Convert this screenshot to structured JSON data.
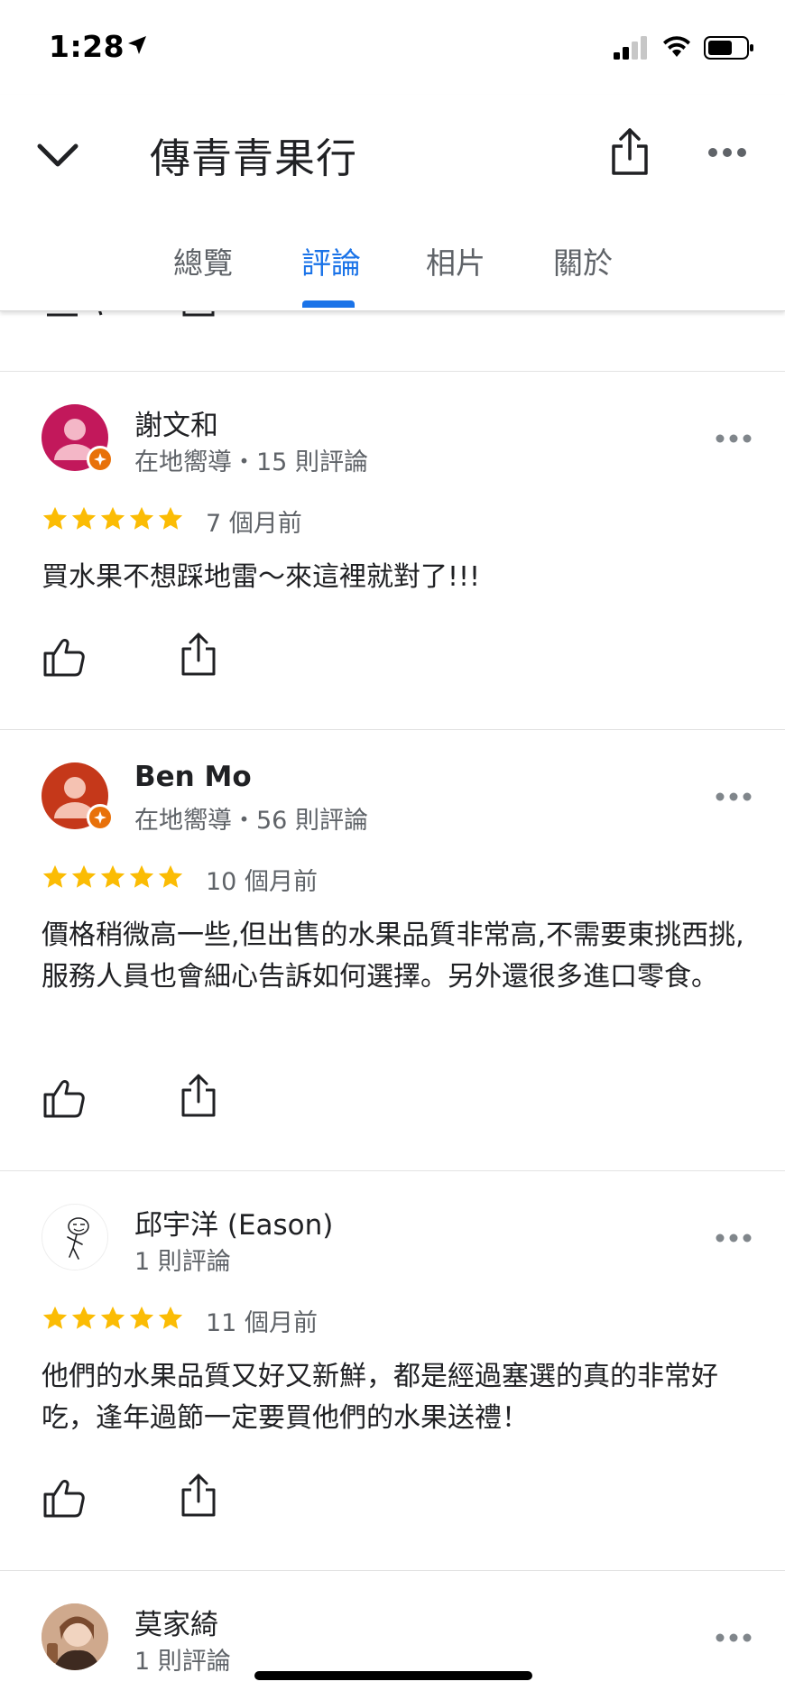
{
  "status": {
    "time": "1:28"
  },
  "header": {
    "title": "傳青青果行"
  },
  "tabs": [
    {
      "label": "總覽",
      "active": false
    },
    {
      "label": "評論",
      "active": true
    },
    {
      "label": "相片",
      "active": false
    },
    {
      "label": "關於",
      "active": false
    }
  ],
  "colors": {
    "accent": "#1a73e8",
    "star": "#fbbc04",
    "badge": "#e8710a"
  },
  "reviews": [
    {
      "name": "謝文和",
      "meta": "在地嚮導・15 則評論",
      "rating": 5,
      "time": "7 個月前",
      "text": "買水果不想踩地雷～來這裡就對了!!!",
      "avatar_color": "#c2185b",
      "local_guide": true
    },
    {
      "name": "Ben Mo",
      "meta": "在地嚮導・56 則評論",
      "rating": 5,
      "time": "10 個月前",
      "text": "價格稍微高一些,但出售的水果品質非常高,不需要東挑西挑,服務人員也會細心告訴如何選擇。另外還很多進口零食。",
      "avatar_color": "#c5381a",
      "local_guide": true
    },
    {
      "name": "邱宇洋 (Eason)",
      "meta": "1 則評論",
      "rating": 5,
      "time": "11 個月前",
      "text": "他們的水果品質又好又新鮮，都是經過塞選的真的非常好吃，逢年過節一定要買他們的水果送禮！",
      "local_guide": false
    },
    {
      "name": "莫家綺",
      "meta": "1 則評論",
      "local_guide": false
    }
  ]
}
